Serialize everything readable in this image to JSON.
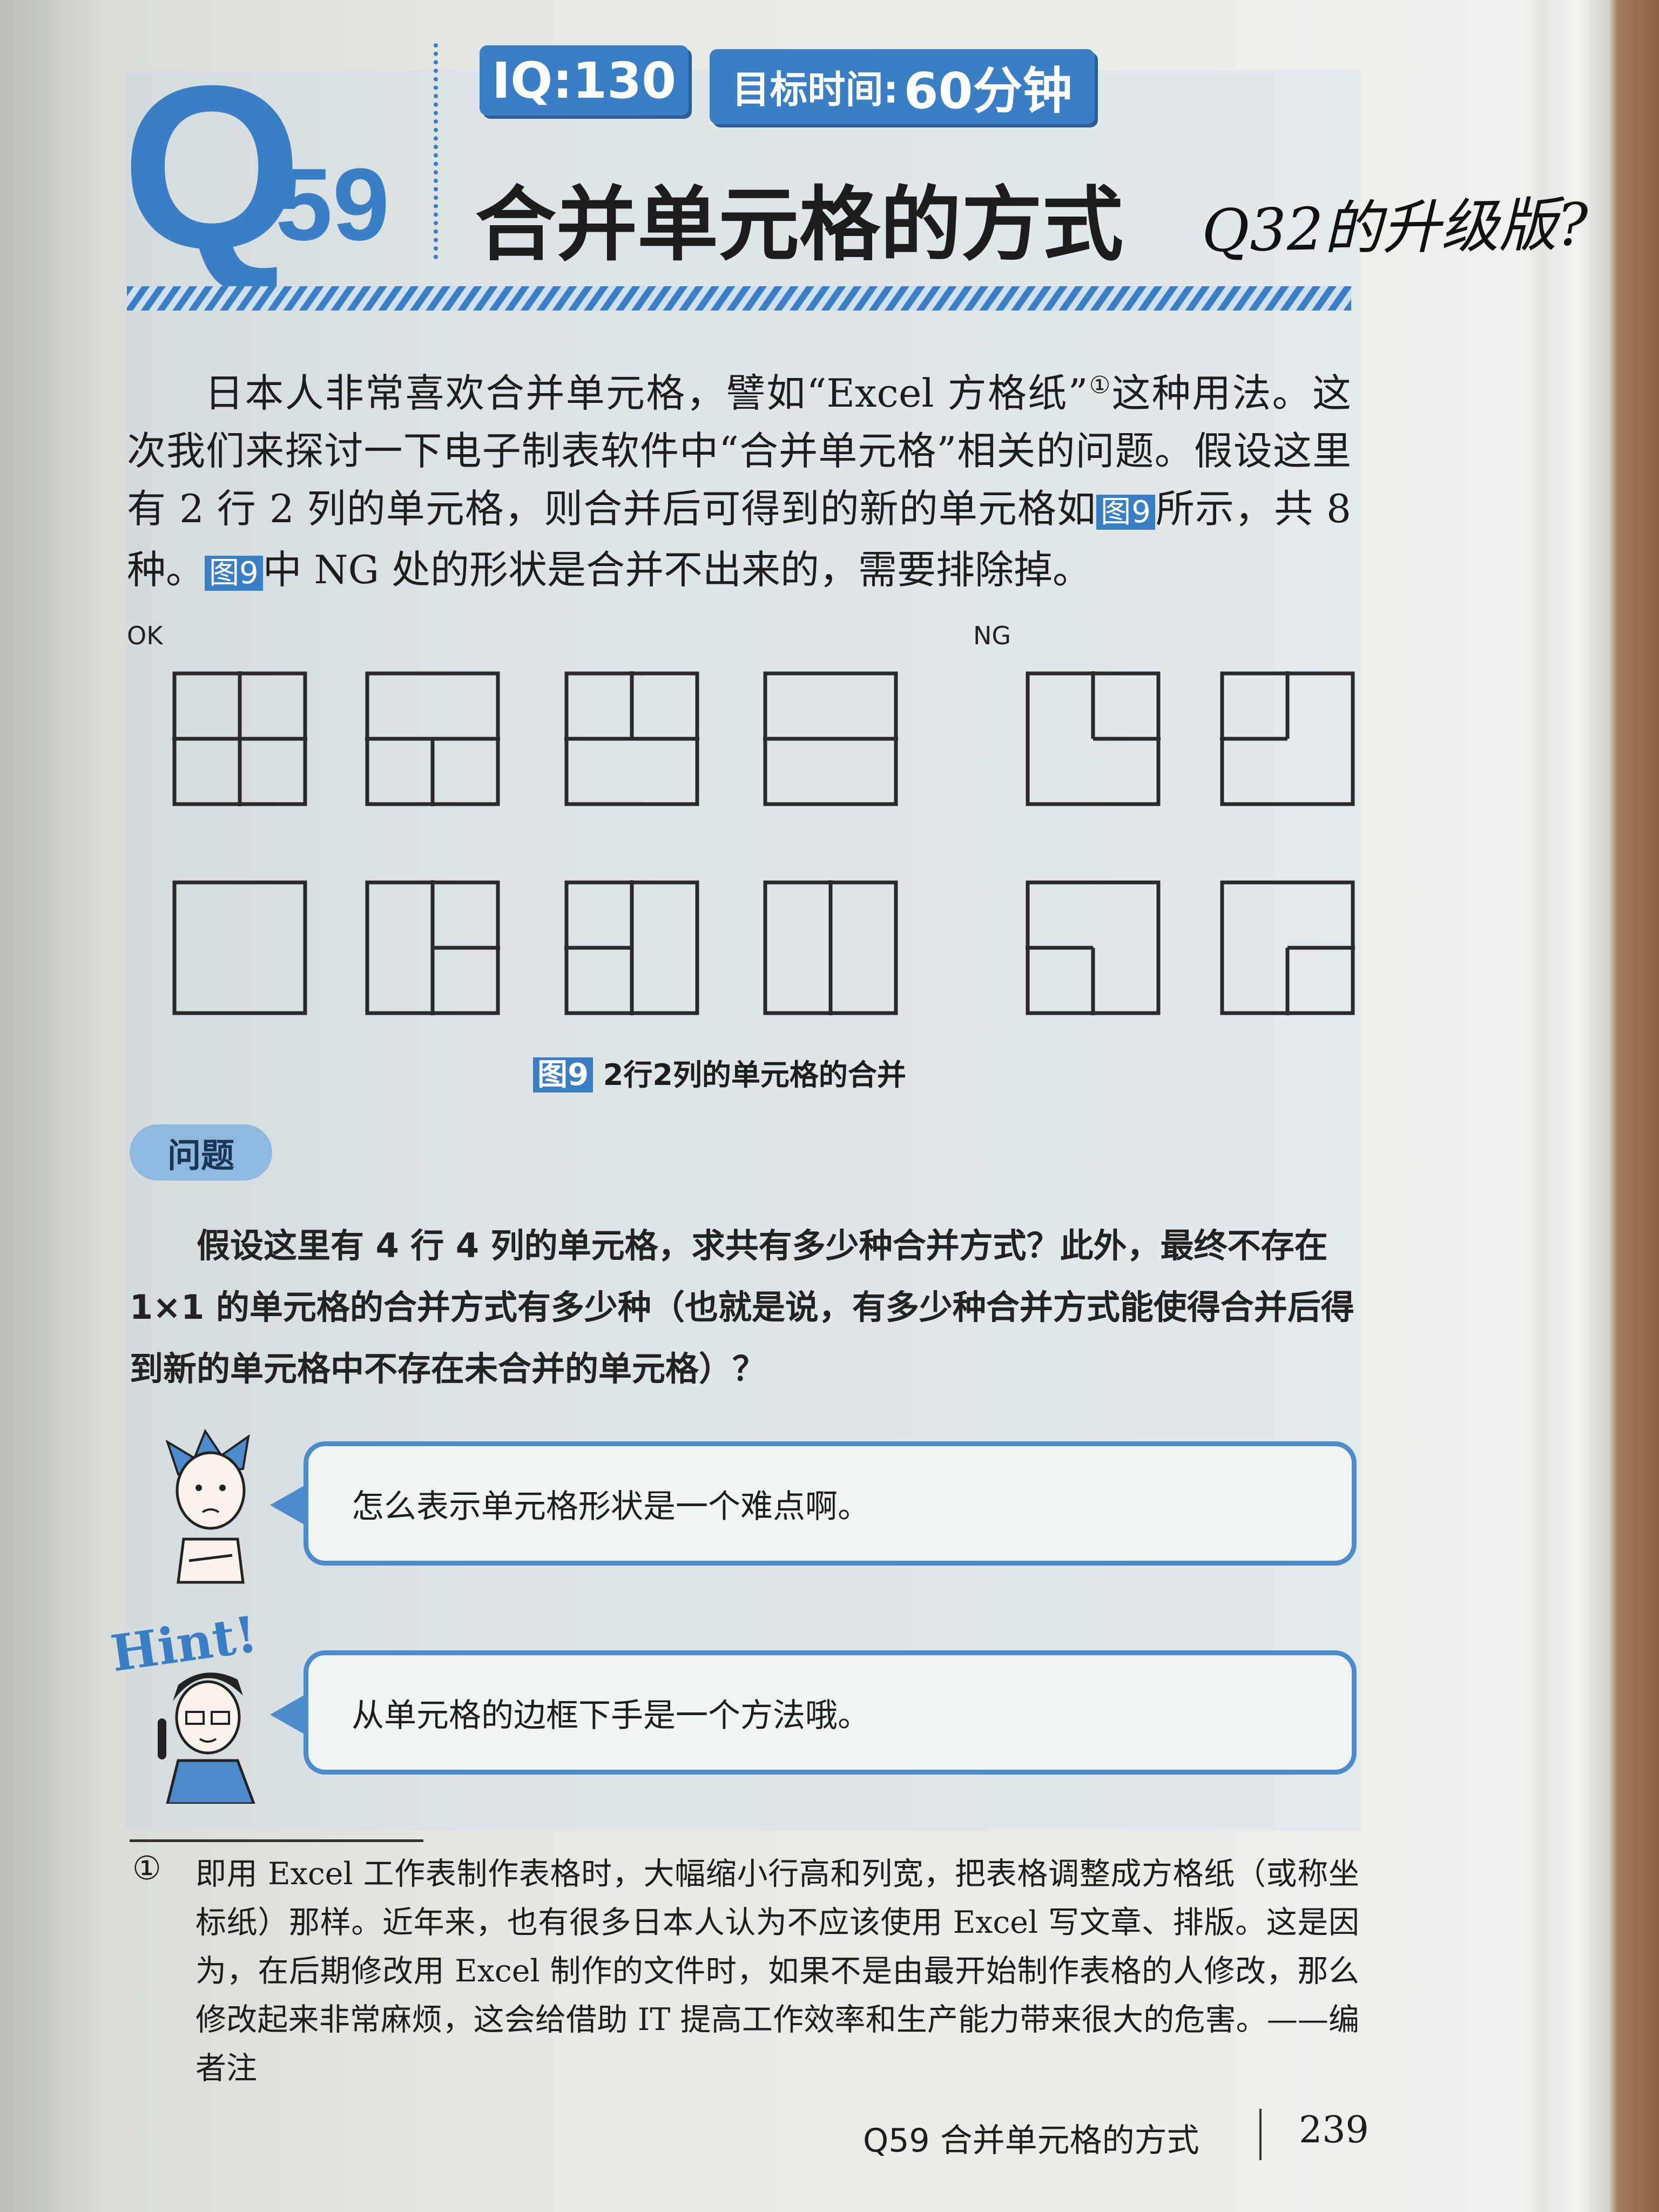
{
  "header": {
    "q_letter": "Q",
    "q_number": "59",
    "iq_badge": "IQ:130",
    "target_time_label": "目标时间:",
    "target_time_value": "60分钟",
    "title": "合并单元格的方式",
    "handwritten_note": "Q32的升级版?"
  },
  "intro": {
    "part1": "日本人非常喜欢合并单元格，譬如“Excel 方格纸”",
    "footnote_mark": "①",
    "part2": "这种用法。这次我们来探讨一下电子制表软件中“合并单元格”相关的问题。假设这里有 2 行 2 列的单元格，则合并后可得到的新的单元格如",
    "fig_ref": "图9",
    "part3": "所示，共 8 种。",
    "part4": "中 NG 处的形状是合并不出来的，需要排除掉。"
  },
  "figure": {
    "ok_label": "OK",
    "ng_label": "NG",
    "caption_ref": "图9",
    "caption": "2行2列的单元格的合并",
    "ok_shapes": [
      [
        "v-top",
        "v-bottom",
        "h-left",
        "h-right"
      ],
      [
        "h-left",
        "h-right",
        "v-bottom"
      ],
      [
        "h-left",
        "h-right",
        "v-top"
      ],
      [
        "h-left",
        "h-right"
      ],
      [],
      [
        "v-top",
        "v-bottom",
        "h-right"
      ],
      [
        "v-top",
        "v-bottom",
        "h-left"
      ],
      [
        "v-top",
        "v-bottom"
      ]
    ],
    "ng_shapes": [
      [
        "v-top",
        "h-right"
      ],
      [
        "v-top",
        "h-left"
      ],
      [
        "h-left",
        "v-bottom"
      ],
      [
        "h-right",
        "v-bottom"
      ]
    ]
  },
  "problem": {
    "label": "问题",
    "text": "假设这里有 4 行 4 列的单元格，求共有多少种合并方式？此外，最终不存在 1×1 的单元格的合并方式有多少种（也就是说，有多少种合并方式能使得合并后得到新的单元格中不存在未合并的单元格）？"
  },
  "dialogue": {
    "speech1": "怎么表示单元格形状是一个难点啊。",
    "hint_label": "Hint!",
    "speech2": "从单元格的边框下手是一个方法哦。"
  },
  "footnote": {
    "mark": "①",
    "text": "即用 Excel 工作表制作表格时，大幅缩小行高和列宽，把表格调整成方格纸（或称坐标纸）那样。近年来，也有很多日本人认为不应该使用 Excel 写文章、排版。这是因为，在后期修改用 Excel 制作的文件时，如果不是由最开始制作表格的人修改，那么修改起来非常麻烦，这会给借助 IT 提高工作效率和生产能力带来很大的危害。——编者注"
  },
  "footer": {
    "section": "Q59  合并单元格的方式",
    "page": "239"
  },
  "colors": {
    "accent": "#3a7ec6",
    "pill": "#8fb8df"
  }
}
